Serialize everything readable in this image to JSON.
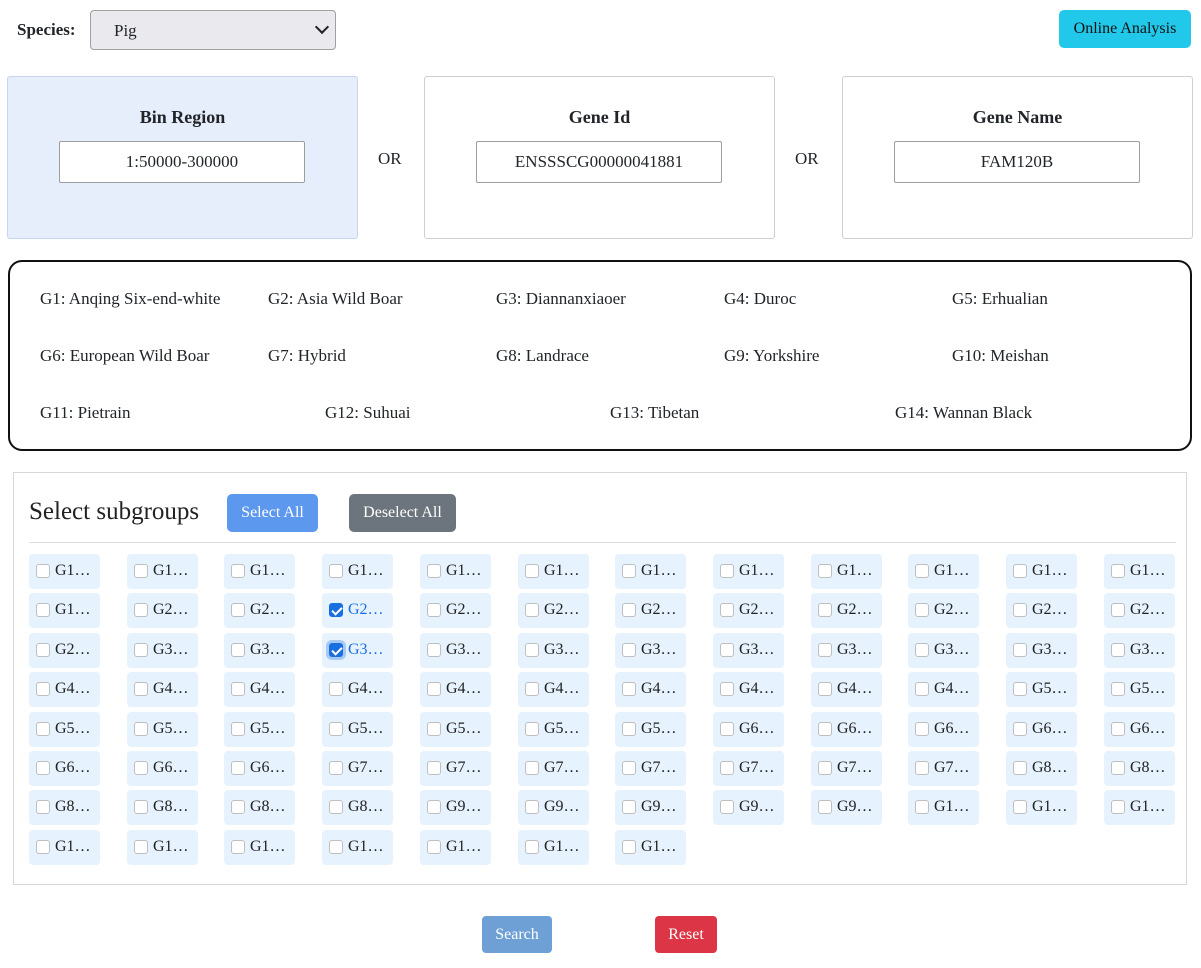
{
  "species": {
    "label": "Species:",
    "selected": "Pig"
  },
  "online_analysis_label": "Online Analysis",
  "search_boxes": [
    {
      "title": "Bin Region",
      "value": "1:50000-300000"
    },
    {
      "title": "Gene Id",
      "value": "ENSSSCG00000041881"
    },
    {
      "title": "Gene Name",
      "value": "FAM120B"
    }
  ],
  "or_label": "OR",
  "groups": [
    "G1: Anqing Six-end-white",
    "G2: Asia Wild Boar",
    "G3: Diannanxiaoer",
    "G4: Duroc",
    "G5: Erhualian",
    "G6: European Wild Boar",
    "G7: Hybrid",
    "G8: Landrace",
    "G9: Yorkshire",
    "G10: Meishan",
    "G11: Pietrain",
    "G12: Suhuai",
    "G13: Tibetan",
    "G14: Wannan Black"
  ],
  "subgroups": {
    "title": "Select subgroups",
    "select_all_label": "Select All",
    "deselect_all_label": "Deselect All",
    "items": [
      {
        "label": "G1…",
        "checked": false
      },
      {
        "label": "G1…",
        "checked": false
      },
      {
        "label": "G1…",
        "checked": false
      },
      {
        "label": "G1…",
        "checked": false
      },
      {
        "label": "G1…",
        "checked": false
      },
      {
        "label": "G1…",
        "checked": false
      },
      {
        "label": "G1…",
        "checked": false
      },
      {
        "label": "G1…",
        "checked": false
      },
      {
        "label": "G1…",
        "checked": false
      },
      {
        "label": "G1…",
        "checked": false
      },
      {
        "label": "G1…",
        "checked": false
      },
      {
        "label": "G1…",
        "checked": false
      },
      {
        "label": "G1…",
        "checked": false
      },
      {
        "label": "G2…",
        "checked": false
      },
      {
        "label": "G2…",
        "checked": false
      },
      {
        "label": "G2…",
        "checked": true
      },
      {
        "label": "G2…",
        "checked": false
      },
      {
        "label": "G2…",
        "checked": false
      },
      {
        "label": "G2…",
        "checked": false
      },
      {
        "label": "G2…",
        "checked": false
      },
      {
        "label": "G2…",
        "checked": false
      },
      {
        "label": "G2…",
        "checked": false
      },
      {
        "label": "G2…",
        "checked": false
      },
      {
        "label": "G2…",
        "checked": false
      },
      {
        "label": "G2…",
        "checked": false
      },
      {
        "label": "G3…",
        "checked": false
      },
      {
        "label": "G3…",
        "checked": false
      },
      {
        "label": "G3…",
        "checked": true,
        "focus": true
      },
      {
        "label": "G3…",
        "checked": false
      },
      {
        "label": "G3…",
        "checked": false
      },
      {
        "label": "G3…",
        "checked": false
      },
      {
        "label": "G3…",
        "checked": false
      },
      {
        "label": "G3…",
        "checked": false
      },
      {
        "label": "G3…",
        "checked": false
      },
      {
        "label": "G3…",
        "checked": false
      },
      {
        "label": "G3…",
        "checked": false
      },
      {
        "label": "G4…",
        "checked": false
      },
      {
        "label": "G4…",
        "checked": false
      },
      {
        "label": "G4…",
        "checked": false
      },
      {
        "label": "G4…",
        "checked": false
      },
      {
        "label": "G4…",
        "checked": false
      },
      {
        "label": "G4…",
        "checked": false
      },
      {
        "label": "G4…",
        "checked": false
      },
      {
        "label": "G4…",
        "checked": false
      },
      {
        "label": "G4…",
        "checked": false
      },
      {
        "label": "G4…",
        "checked": false
      },
      {
        "label": "G5…",
        "checked": false
      },
      {
        "label": "G5…",
        "checked": false
      },
      {
        "label": "G5…",
        "checked": false
      },
      {
        "label": "G5…",
        "checked": false
      },
      {
        "label": "G5…",
        "checked": false
      },
      {
        "label": "G5…",
        "checked": false
      },
      {
        "label": "G5…",
        "checked": false
      },
      {
        "label": "G5…",
        "checked": false
      },
      {
        "label": "G5…",
        "checked": false
      },
      {
        "label": "G6…",
        "checked": false
      },
      {
        "label": "G6…",
        "checked": false
      },
      {
        "label": "G6…",
        "checked": false
      },
      {
        "label": "G6…",
        "checked": false
      },
      {
        "label": "G6…",
        "checked": false
      },
      {
        "label": "G6…",
        "checked": false
      },
      {
        "label": "G6…",
        "checked": false
      },
      {
        "label": "G6…",
        "checked": false
      },
      {
        "label": "G7…",
        "checked": false
      },
      {
        "label": "G7…",
        "checked": false
      },
      {
        "label": "G7…",
        "checked": false
      },
      {
        "label": "G7…",
        "checked": false
      },
      {
        "label": "G7…",
        "checked": false
      },
      {
        "label": "G7…",
        "checked": false
      },
      {
        "label": "G7…",
        "checked": false
      },
      {
        "label": "G8…",
        "checked": false
      },
      {
        "label": "G8…",
        "checked": false
      },
      {
        "label": "G8…",
        "checked": false
      },
      {
        "label": "G8…",
        "checked": false
      },
      {
        "label": "G8…",
        "checked": false
      },
      {
        "label": "G8…",
        "checked": false
      },
      {
        "label": "G9…",
        "checked": false
      },
      {
        "label": "G9…",
        "checked": false
      },
      {
        "label": "G9…",
        "checked": false
      },
      {
        "label": "G9…",
        "checked": false
      },
      {
        "label": "G9…",
        "checked": false
      },
      {
        "label": "G1…",
        "checked": false
      },
      {
        "label": "G1…",
        "checked": false
      },
      {
        "label": "G1…",
        "checked": false
      },
      {
        "label": "G1…",
        "checked": false
      },
      {
        "label": "G1…",
        "checked": false
      },
      {
        "label": "G1…",
        "checked": false
      },
      {
        "label": "G1…",
        "checked": false
      },
      {
        "label": "G1…",
        "checked": false
      },
      {
        "label": "G1…",
        "checked": false
      },
      {
        "label": "G1…",
        "checked": false
      }
    ]
  },
  "search_label": "Search",
  "reset_label": "Reset"
}
